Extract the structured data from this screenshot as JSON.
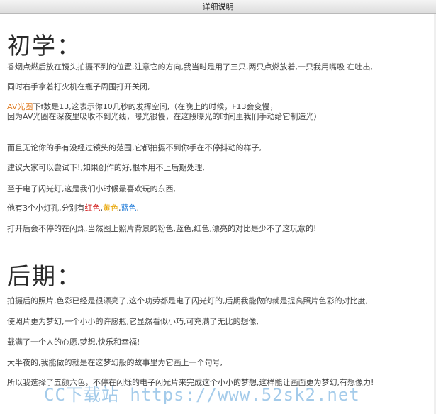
{
  "window": {
    "title": "详细说明"
  },
  "section1": {
    "heading": "初学：",
    "lines": [
      "香烟点燃后放在镜头拍摄不到的位置,注意它的方向,我当时是用了三只,两只点燃放着,一只我用嘴吸 在吐出,",
      "同时右手拿着打火机在瓶子周围打开关闭,"
    ],
    "av_prefix": "AV光圈",
    "av_line1_rest": "下f数是13,这表示你10几秒的发挥空间,（在晚上的时候，F13会变慢，",
    "av_line2": "因为AV光圈在深夜里吸收不到光线，曝光很慢，在这段曝光的时间里我们手动给它制造光）",
    "lines2": [
      "而且无论你的手有没经过镜头的范围,它都拍摄不到你手在不停抖动的样子,",
      "建议大家可以尝试下!,如果创作的好,根本用不上后期处理,",
      "至于电子闪光灯,这是我们小时候最喜欢玩的东西,"
    ],
    "lights_prefix": "他有3个小灯孔,分别有",
    "light_red": "红色",
    "light_yellow": "黄色",
    "light_blue": "蓝色",
    "lights_suffix": ",",
    "sep1": ",",
    "sep2": ",",
    "line_last": "打开后会不停的在闪烁,当然图上照片背景的粉色,蓝色,红色,漂亮的对比是少不了这玩意的!"
  },
  "section2": {
    "heading": "后期：",
    "lines": [
      "拍摄后的照片,色彩已经是很漂亮了,这个功劳都是电子闪光灯的,后期我能做的就是提高照片色彩的对比度,",
      "使照片更为梦幻,一个小小的许愿瓶,它显然看似小巧,可充满了无比的想像,",
      "载满了一个人的心愿,梦想,快乐和幸福!",
      "大半夜的,我能做的就是在这梦幻般的故事里为它画上一个句号,",
      "所以我选择了五颜六色，不停在闪烁的电子闪光片来完成这个小小的梦想,这样能让画面更为梦幻,有想像力!"
    ]
  },
  "watermark": "CC下载站 https://www.52sk2.net"
}
